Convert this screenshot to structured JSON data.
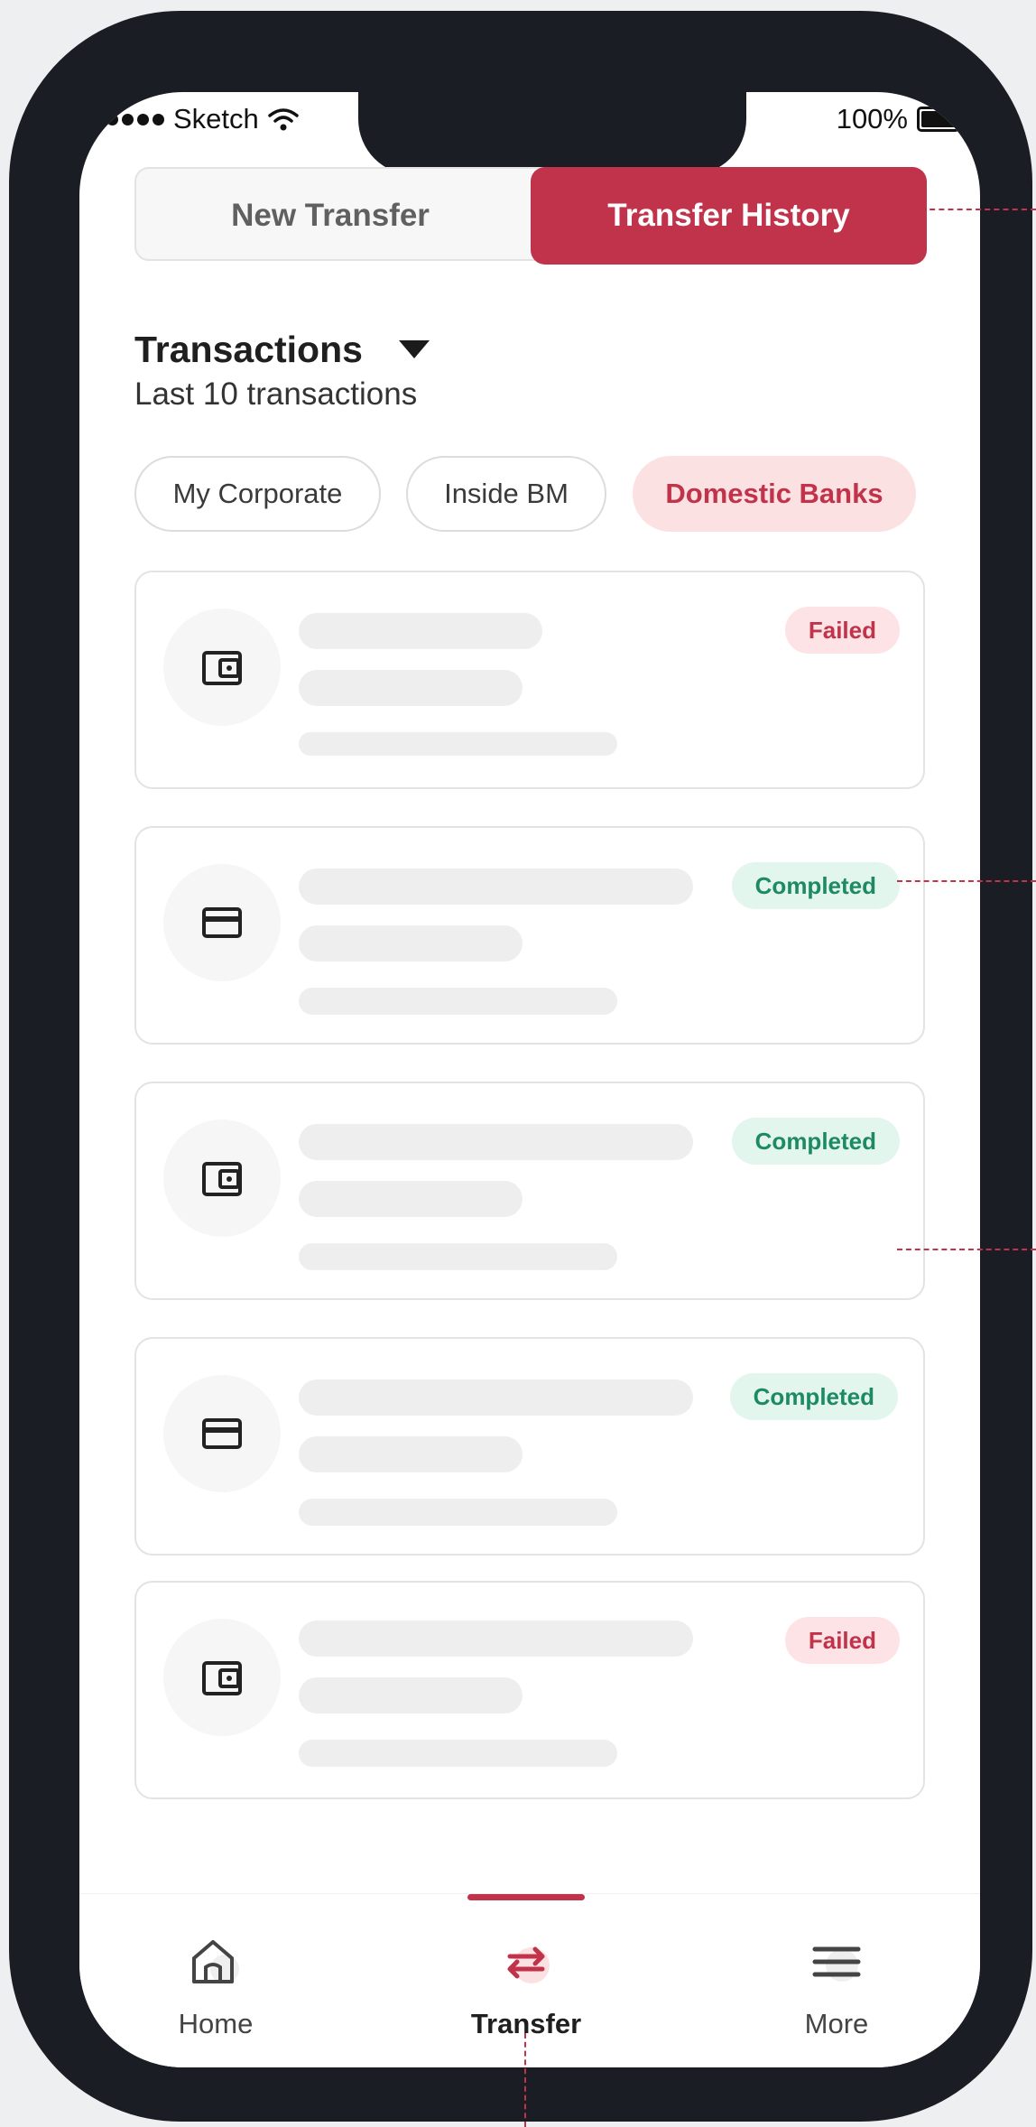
{
  "status_bar": {
    "carrier": "Sketch",
    "battery": "100%"
  },
  "segment": {
    "new_transfer": "New Transfer",
    "transfer_history": "Transfer History"
  },
  "transactions": {
    "title": "Transactions",
    "subtitle": "Last 10 transactions"
  },
  "filters": [
    "My Corporate",
    "Inside BM",
    "Domestic Banks"
  ],
  "cards": [
    {
      "icon": "wallet-icon",
      "status": "Failed"
    },
    {
      "icon": "card-icon",
      "status": "Completed"
    },
    {
      "icon": "wallet-icon",
      "status": "Completed"
    },
    {
      "icon": "card-icon",
      "status": "Completed"
    },
    {
      "icon": "wallet-icon",
      "status": "Failed"
    }
  ],
  "nav": {
    "home": "Home",
    "transfer": "Transfer",
    "more": "More"
  },
  "colors": {
    "accent": "#c0334a",
    "failed_bg": "#fde3e5",
    "completed_bg": "#e3f6ee",
    "completed_text": "#1e8a62"
  }
}
